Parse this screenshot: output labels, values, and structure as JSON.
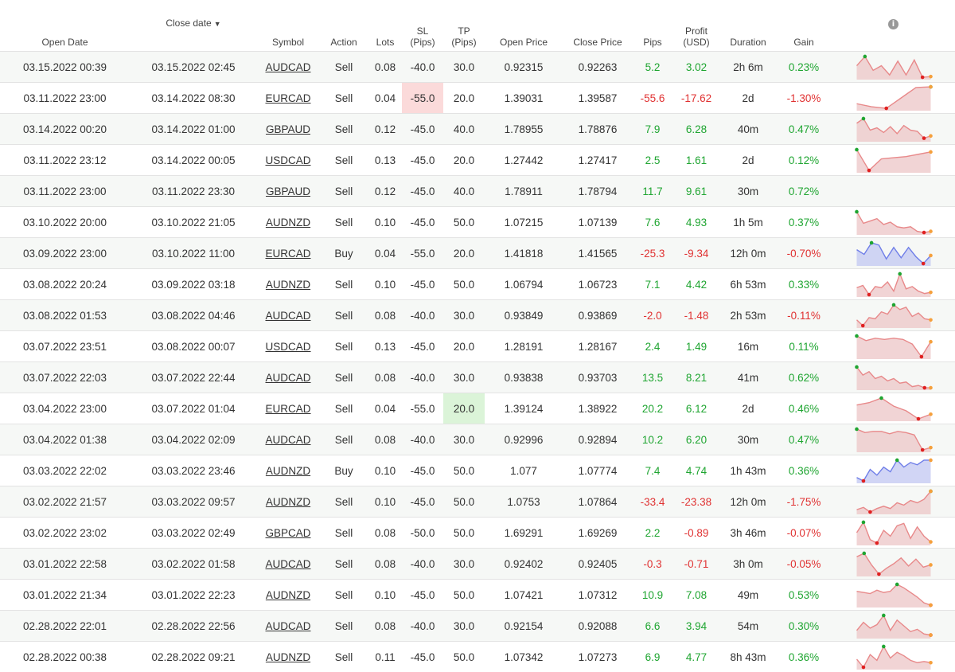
{
  "header": {
    "open_date": "Open Date",
    "close_date": "Close date",
    "close_date_sort": "▼",
    "symbol": "Symbol",
    "action": "Action",
    "lots": "Lots",
    "sl_line1": "SL",
    "sl_line2": "(Pips)",
    "tp_line1": "TP",
    "tp_line2": "(Pips)",
    "open_price": "Open Price",
    "close_price": "Close Price",
    "pips": "Pips",
    "profit_line1": "Profit",
    "profit_line2": "(USD)",
    "duration": "Duration",
    "gain": "Gain",
    "info_icon": "info-icon",
    "info_glyph": "i"
  },
  "colors": {
    "positive": "#1fa531",
    "negative": "#e03232",
    "sell_line": "#e8898a",
    "sell_fill": "#edc9ca",
    "buy_line": "#6f7ee8",
    "buy_fill": "#c5cbf3",
    "marker_green": "#1fa531",
    "marker_red": "#e02020",
    "marker_orange": "#f5a03c"
  },
  "trades": [
    {
      "open": "03.15.2022 00:39",
      "close": "03.15.2022 02:45",
      "symbol": "AUDCAD",
      "action": "Sell",
      "lots": "0.08",
      "sl": "-40.0",
      "tp": "30.0",
      "open_price": "0.92315",
      "close_price": "0.92263",
      "pips": "5.2",
      "profit": "3.02",
      "duration": "2h 6m",
      "gain": "0.23%",
      "spark": [
        0.55,
        0.95,
        0.35,
        0.55,
        0.15,
        0.75,
        0.15,
        0.8,
        0.05,
        0.08
      ]
    },
    {
      "open": "03.11.2022 23:00",
      "close": "03.14.2022 08:30",
      "symbol": "EURCAD",
      "action": "Sell",
      "lots": "0.04",
      "sl": "-55.0",
      "tp": "20.0",
      "open_price": "1.39031",
      "close_price": "1.39587",
      "pips": "-55.6",
      "profit": "-17.62",
      "duration": "2d",
      "gain": "-1.30%",
      "sl_hit": true,
      "spark": [
        0.25,
        0.12,
        0.05,
        0.5,
        0.95,
        0.98
      ]
    },
    {
      "open": "03.14.2022 00:20",
      "close": "03.14.2022 01:00",
      "symbol": "GBPAUD",
      "action": "Sell",
      "lots": "0.12",
      "sl": "-45.0",
      "tp": "40.0",
      "open_price": "1.78955",
      "close_price": "1.78876",
      "pips": "7.9",
      "profit": "6.28",
      "duration": "40m",
      "gain": "0.47%",
      "spark": [
        0.75,
        0.95,
        0.45,
        0.55,
        0.35,
        0.6,
        0.3,
        0.65,
        0.45,
        0.4,
        0.1,
        0.2
      ]
    },
    {
      "open": "03.11.2022 23:12",
      "close": "03.14.2022 00:05",
      "symbol": "USDCAD",
      "action": "Sell",
      "lots": "0.13",
      "sl": "-45.0",
      "tp": "20.0",
      "open_price": "1.27442",
      "close_price": "1.27417",
      "pips": "2.5",
      "profit": "1.61",
      "duration": "2d",
      "gain": "0.12%",
      "spark": [
        0.95,
        0.05,
        0.55,
        0.6,
        0.65,
        0.75,
        0.85
      ]
    },
    {
      "open": "03.11.2022 23:00",
      "close": "03.11.2022 23:30",
      "symbol": "GBPAUD",
      "action": "Sell",
      "lots": "0.12",
      "sl": "-45.0",
      "tp": "40.0",
      "open_price": "1.78911",
      "close_price": "1.78794",
      "pips": "11.7",
      "profit": "9.61",
      "duration": "30m",
      "gain": "0.72%",
      "spark": []
    },
    {
      "open": "03.10.2022 20:00",
      "close": "03.10.2022 21:05",
      "symbol": "AUDNZD",
      "action": "Sell",
      "lots": "0.10",
      "sl": "-45.0",
      "tp": "50.0",
      "open_price": "1.07215",
      "close_price": "1.07139",
      "pips": "7.6",
      "profit": "4.93",
      "duration": "1h 5m",
      "gain": "0.37%",
      "spark": [
        0.95,
        0.45,
        0.55,
        0.65,
        0.4,
        0.5,
        0.3,
        0.25,
        0.3,
        0.1,
        0.05,
        0.1
      ]
    },
    {
      "open": "03.09.2022 23:00",
      "close": "03.10.2022 11:00",
      "symbol": "EURCAD",
      "action": "Buy",
      "lots": "0.04",
      "sl": "-55.0",
      "tp": "20.0",
      "open_price": "1.41818",
      "close_price": "1.41565",
      "pips": "-25.3",
      "profit": "-9.34",
      "duration": "12h 0m",
      "gain": "-0.70%",
      "spark": [
        0.65,
        0.45,
        0.95,
        0.85,
        0.25,
        0.75,
        0.3,
        0.75,
        0.35,
        0.05,
        0.4
      ]
    },
    {
      "open": "03.08.2022 20:24",
      "close": "03.09.2022 03:18",
      "symbol": "AUDNZD",
      "action": "Sell",
      "lots": "0.10",
      "sl": "-45.0",
      "tp": "50.0",
      "open_price": "1.06794",
      "close_price": "1.06723",
      "pips": "7.1",
      "profit": "4.42",
      "duration": "6h 53m",
      "gain": "0.33%",
      "spark": [
        0.35,
        0.45,
        0.05,
        0.4,
        0.35,
        0.6,
        0.2,
        0.95,
        0.3,
        0.4,
        0.2,
        0.1,
        0.15
      ]
    },
    {
      "open": "03.08.2022 01:53",
      "close": "03.08.2022 04:46",
      "symbol": "AUDCAD",
      "action": "Sell",
      "lots": "0.08",
      "sl": "-40.0",
      "tp": "30.0",
      "open_price": "0.93849",
      "close_price": "0.93869",
      "pips": "-2.0",
      "profit": "-1.48",
      "duration": "2h 53m",
      "gain": "-0.11%",
      "spark": [
        0.3,
        0.05,
        0.4,
        0.35,
        0.65,
        0.55,
        0.95,
        0.75,
        0.85,
        0.45,
        0.6,
        0.35,
        0.3
      ]
    },
    {
      "open": "03.07.2022 23:51",
      "close": "03.08.2022 00:07",
      "symbol": "USDCAD",
      "action": "Sell",
      "lots": "0.13",
      "sl": "-45.0",
      "tp": "20.0",
      "open_price": "1.28191",
      "close_price": "1.28167",
      "pips": "2.4",
      "profit": "1.49",
      "duration": "16m",
      "gain": "0.11%",
      "spark": [
        0.95,
        0.75,
        0.85,
        0.8,
        0.85,
        0.8,
        0.6,
        0.05,
        0.7
      ]
    },
    {
      "open": "03.07.2022 22:03",
      "close": "03.07.2022 22:44",
      "symbol": "AUDCAD",
      "action": "Sell",
      "lots": "0.08",
      "sl": "-40.0",
      "tp": "30.0",
      "open_price": "0.93838",
      "close_price": "0.93703",
      "pips": "13.5",
      "profit": "8.21",
      "duration": "41m",
      "gain": "0.62%",
      "spark": [
        0.95,
        0.6,
        0.75,
        0.45,
        0.55,
        0.35,
        0.45,
        0.25,
        0.3,
        0.1,
        0.15,
        0.05,
        0.05
      ]
    },
    {
      "open": "03.04.2022 23:00",
      "close": "03.07.2022 01:04",
      "symbol": "EURCAD",
      "action": "Sell",
      "lots": "0.04",
      "sl": "-55.0",
      "tp": "20.0",
      "open_price": "1.39124",
      "close_price": "1.38922",
      "pips": "20.2",
      "profit": "6.12",
      "duration": "2d",
      "gain": "0.46%",
      "tp_hit": true,
      "spark": [
        0.65,
        0.75,
        0.95,
        0.6,
        0.4,
        0.05,
        0.25
      ]
    },
    {
      "open": "03.04.2022 01:38",
      "close": "03.04.2022 02:09",
      "symbol": "AUDCAD",
      "action": "Sell",
      "lots": "0.08",
      "sl": "-40.0",
      "tp": "30.0",
      "open_price": "0.92996",
      "close_price": "0.92894",
      "pips": "10.2",
      "profit": "6.20",
      "duration": "30m",
      "gain": "0.47%",
      "spark": [
        0.95,
        0.8,
        0.85,
        0.85,
        0.75,
        0.85,
        0.8,
        0.7,
        0.05,
        0.15
      ]
    },
    {
      "open": "03.03.2022 22:02",
      "close": "03.03.2022 23:46",
      "symbol": "AUDNZD",
      "action": "Buy",
      "lots": "0.10",
      "sl": "-45.0",
      "tp": "50.0",
      "open_price": "1.077",
      "close_price": "1.07774",
      "pips": "7.4",
      "profit": "4.74",
      "duration": "1h 43m",
      "gain": "0.36%",
      "spark": [
        0.2,
        0.05,
        0.55,
        0.3,
        0.65,
        0.45,
        0.95,
        0.65,
        0.85,
        0.75,
        0.95,
        0.95
      ]
    },
    {
      "open": "03.02.2022 21:57",
      "close": "03.03.2022 09:57",
      "symbol": "AUDNZD",
      "action": "Sell",
      "lots": "0.10",
      "sl": "-45.0",
      "tp": "50.0",
      "open_price": "1.0753",
      "close_price": "1.07864",
      "pips": "-33.4",
      "profit": "-23.38",
      "duration": "12h 0m",
      "gain": "-1.75%",
      "spark": [
        0.15,
        0.25,
        0.05,
        0.2,
        0.3,
        0.2,
        0.45,
        0.35,
        0.55,
        0.45,
        0.6,
        0.95
      ]
    },
    {
      "open": "03.02.2022 23:02",
      "close": "03.03.2022 02:49",
      "symbol": "GBPCAD",
      "action": "Sell",
      "lots": "0.08",
      "sl": "-50.0",
      "tp": "50.0",
      "open_price": "1.69291",
      "close_price": "1.69269",
      "pips": "2.2",
      "profit": "-0.89",
      "duration": "3h 46m",
      "gain": "-0.07%",
      "spark": [
        0.5,
        0.95,
        0.2,
        0.05,
        0.6,
        0.35,
        0.8,
        0.9,
        0.25,
        0.75,
        0.35,
        0.1
      ]
    },
    {
      "open": "03.01.2022 22:58",
      "close": "03.02.2022 01:58",
      "symbol": "AUDCAD",
      "action": "Sell",
      "lots": "0.08",
      "sl": "-40.0",
      "tp": "30.0",
      "open_price": "0.92402",
      "close_price": "0.92405",
      "pips": "-0.3",
      "profit": "-0.71",
      "duration": "3h 0m",
      "gain": "-0.05%",
      "spark": [
        0.8,
        0.95,
        0.45,
        0.05,
        0.3,
        0.5,
        0.75,
        0.4,
        0.7,
        0.35,
        0.45
      ]
    },
    {
      "open": "03.01.2022 21:34",
      "close": "03.01.2022 22:23",
      "symbol": "AUDNZD",
      "action": "Sell",
      "lots": "0.10",
      "sl": "-45.0",
      "tp": "50.0",
      "open_price": "1.07421",
      "close_price": "1.07312",
      "pips": "10.9",
      "profit": "7.08",
      "duration": "49m",
      "gain": "0.53%",
      "spark": [
        0.65,
        0.6,
        0.55,
        0.7,
        0.6,
        0.65,
        0.95,
        0.8,
        0.6,
        0.4,
        0.15,
        0.05
      ]
    },
    {
      "open": "02.28.2022 22:01",
      "close": "02.28.2022 22:56",
      "symbol": "AUDCAD",
      "action": "Sell",
      "lots": "0.08",
      "sl": "-40.0",
      "tp": "30.0",
      "open_price": "0.92154",
      "close_price": "0.92088",
      "pips": "6.6",
      "profit": "3.94",
      "duration": "54m",
      "gain": "0.30%",
      "spark": [
        0.3,
        0.65,
        0.4,
        0.55,
        0.95,
        0.3,
        0.75,
        0.5,
        0.25,
        0.35,
        0.15,
        0.1
      ]
    },
    {
      "open": "02.28.2022 00:38",
      "close": "02.28.2022 09:21",
      "symbol": "AUDNZD",
      "action": "Sell",
      "lots": "0.11",
      "sl": "-45.0",
      "tp": "50.0",
      "open_price": "1.07342",
      "close_price": "1.07273",
      "pips": "6.9",
      "profit": "4.77",
      "duration": "8h 43m",
      "gain": "0.36%",
      "spark": [
        0.4,
        0.05,
        0.6,
        0.35,
        0.95,
        0.45,
        0.7,
        0.55,
        0.35,
        0.25,
        0.3,
        0.25
      ]
    }
  ]
}
